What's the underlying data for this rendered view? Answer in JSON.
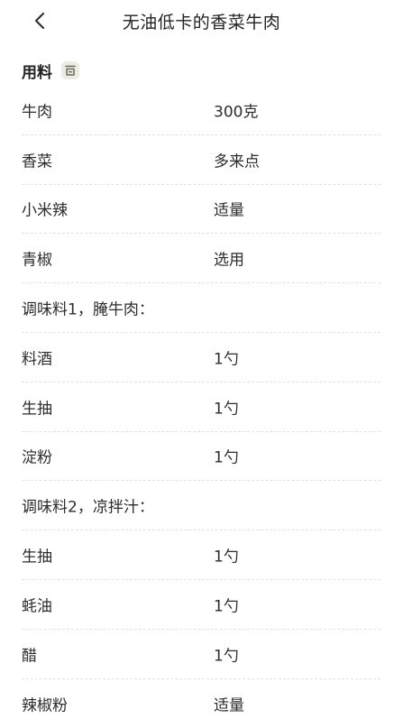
{
  "header": {
    "title": "无油低卡的香菜牛肉",
    "back_icon": "chevron-left-icon"
  },
  "ingredients": {
    "section_title": "用料",
    "section_icon": "recipe-scale-icon",
    "rows": [
      {
        "name": "牛肉",
        "amount": "300克"
      },
      {
        "name": "香菜",
        "amount": "多来点"
      },
      {
        "name": "小米辣",
        "amount": "适量"
      },
      {
        "name": "青椒",
        "amount": "选用"
      },
      {
        "name": "调味料1，腌牛肉：",
        "amount": ""
      },
      {
        "name": "料酒",
        "amount": "1勺"
      },
      {
        "name": "生抽",
        "amount": "1勺"
      },
      {
        "name": "淀粉",
        "amount": "1勺"
      },
      {
        "name": "调味料2，凉拌汁：",
        "amount": ""
      },
      {
        "name": "生抽",
        "amount": "1勺"
      },
      {
        "name": "蚝油",
        "amount": "1勺"
      },
      {
        "name": "醋",
        "amount": "1勺"
      },
      {
        "name": "辣椒粉",
        "amount": "适量"
      }
    ]
  }
}
